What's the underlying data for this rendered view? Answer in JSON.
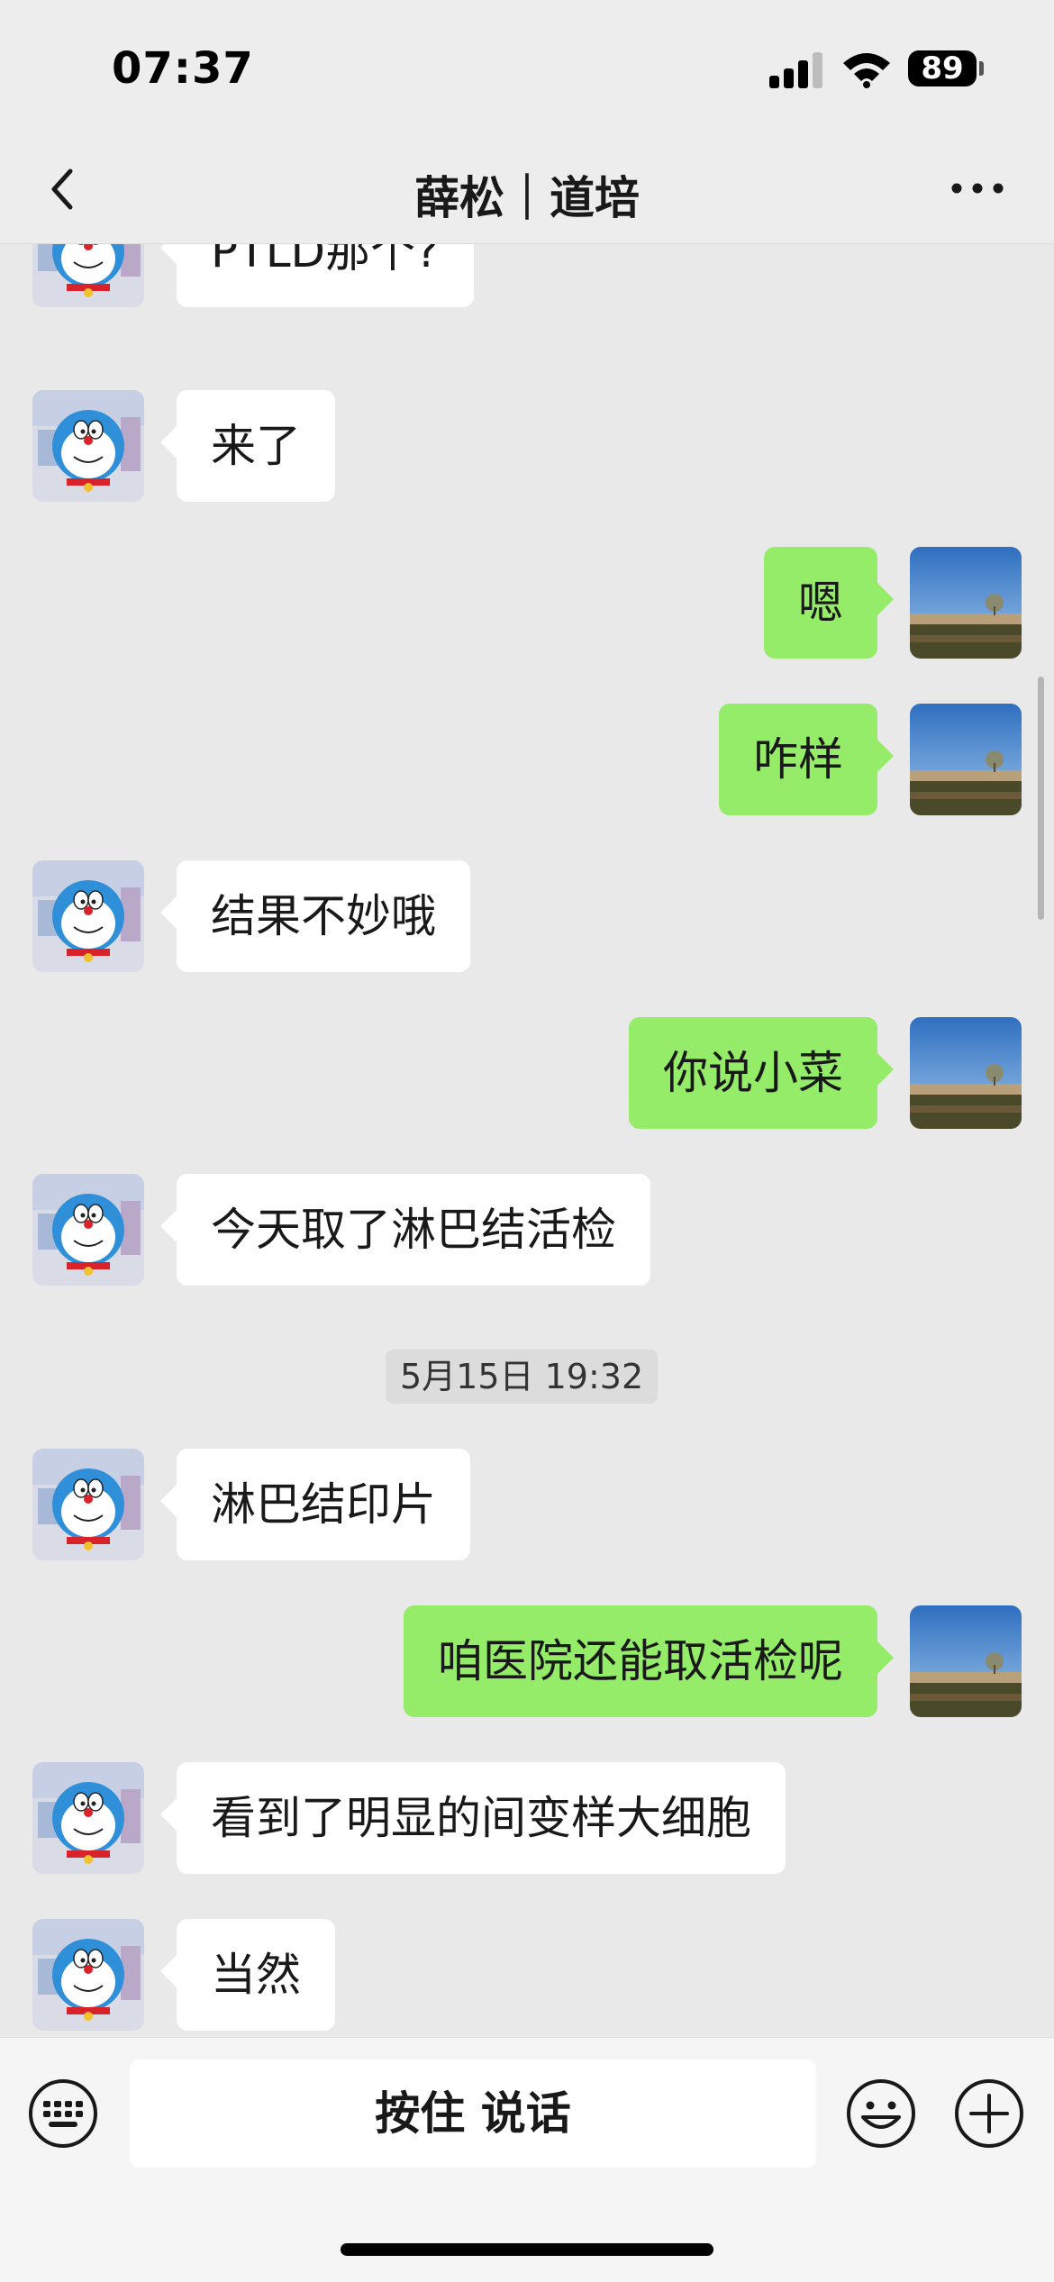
{
  "status_bar": {
    "time": "07:37",
    "battery": "89"
  },
  "nav": {
    "title": "薛松｜道培",
    "back_icon": "chevron-left-icon",
    "more_icon": "more-dots-icon"
  },
  "messages": [
    {
      "side": "in",
      "text": "PTLD那个?"
    },
    {
      "side": "in",
      "text": "来了"
    },
    {
      "side": "out",
      "text": "嗯"
    },
    {
      "side": "out",
      "text": "咋样"
    },
    {
      "side": "in",
      "text": "结果不妙哦"
    },
    {
      "side": "out",
      "text": "你说小菜"
    },
    {
      "side": "in",
      "text": "今天取了淋巴结活检"
    },
    {
      "side": "in",
      "text": "淋巴结印片"
    },
    {
      "side": "out",
      "text": "咱医院还能取活检呢"
    },
    {
      "side": "in",
      "text": "看到了明显的间变样大细胞"
    },
    {
      "side": "in",
      "text": "当然"
    }
  ],
  "timestamp": "5月15日 19:32",
  "input_bar": {
    "hold_to_talk": "按住 说话",
    "left_icon": "keyboard-icon",
    "emoji_icon": "emoji-icon",
    "plus_icon": "plus-icon"
  },
  "colors": {
    "outgoing_bubble": "#95ec69",
    "incoming_bubble": "#ffffff",
    "chat_background": "#e9e9e9"
  }
}
